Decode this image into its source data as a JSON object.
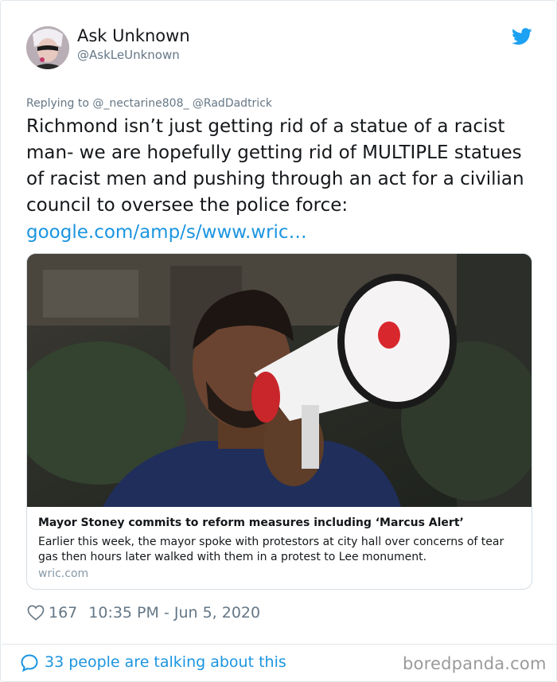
{
  "author": {
    "display_name": "Ask Unknown",
    "handle": "@AskLeUnknown"
  },
  "reply_context": "Replying to @_nectarine808_ @RadDadtrick",
  "tweet": {
    "text": "Richmond isn’t just getting rid of a statue of a racist man- we are hopefully getting rid of MULTIPLE statues of racist men and pushing through an act for a civilian council to oversee the police force:",
    "link": "google.com/amp/s/www.wric…"
  },
  "card": {
    "title": "Mayor Stoney commits to reform measures including ‘Marcus Alert’",
    "description": "Earlier this week, the mayor spoke with protestors at city hall over concerns of tear gas then hours later walked with them in a protest to Lee monument.",
    "domain": "wric.com"
  },
  "meta": {
    "likes": "167",
    "timestamp": "10:35 PM - Jun 5, 2020"
  },
  "footer": {
    "talking": "33 people are talking about this",
    "watermark": "boredpanda.com"
  },
  "colors": {
    "link": "#1b95e0",
    "secondary_text": "#657786",
    "twitter_blue": "#1da1f2"
  },
  "icons": [
    "twitter-bird-icon",
    "heart-icon",
    "speech-bubble-icon"
  ]
}
